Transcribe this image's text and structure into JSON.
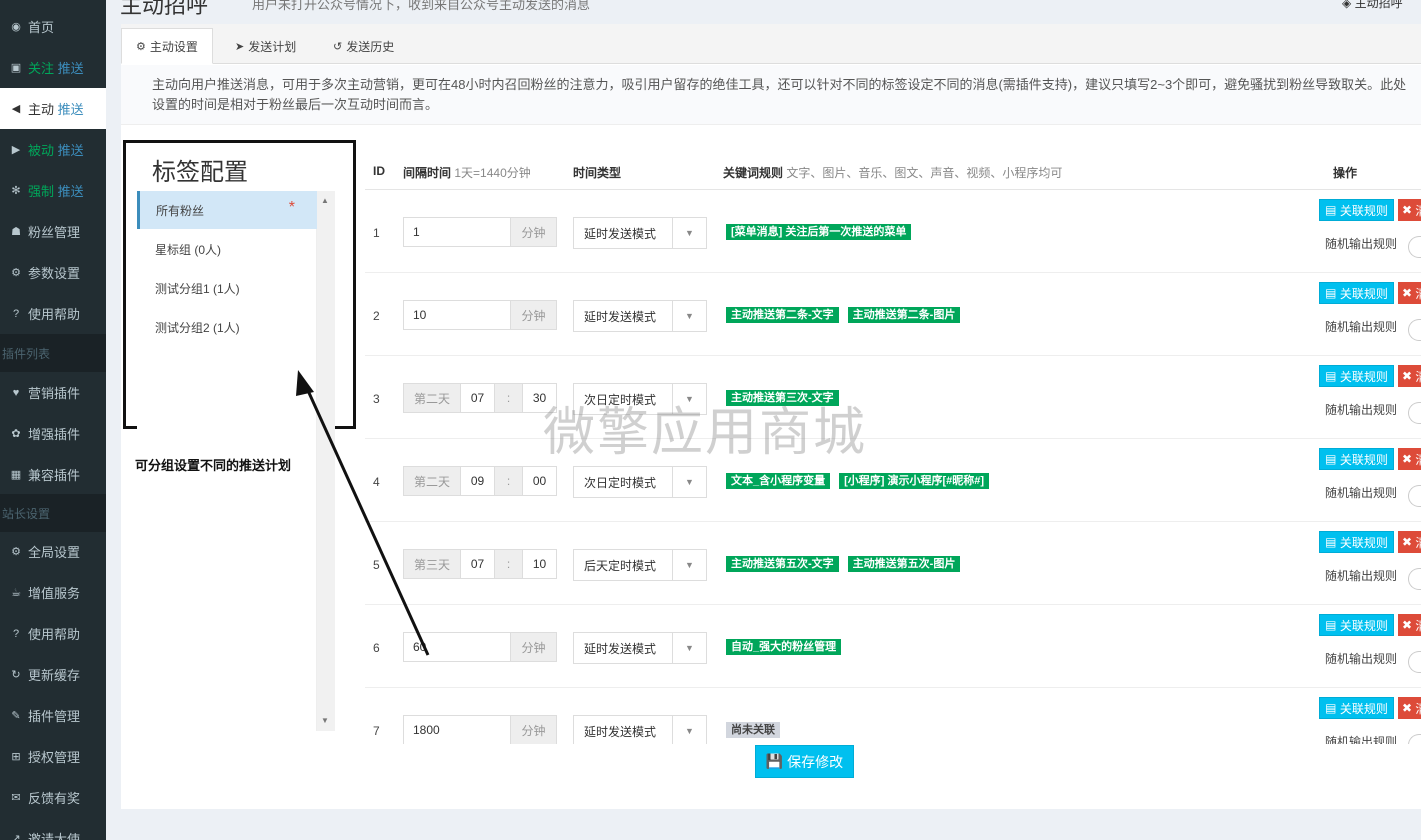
{
  "header": {
    "title": "主动招呼",
    "subtitle": "用户未打开公众号情况下，收到来自公众号主动发送的消息",
    "top_right": "主动招呼"
  },
  "sidebar": {
    "items": [
      {
        "icon": "dashboard-icon",
        "label": "首页",
        "tag": ""
      },
      {
        "icon": "rss-icon",
        "label": "关注",
        "tag": "推送"
      },
      {
        "icon": "arrow-circle-left-icon",
        "label": "主动",
        "tag": "推送"
      },
      {
        "icon": "arrow-circle-right-icon",
        "label": "被动",
        "tag": "推送"
      },
      {
        "icon": "asterisk-circle-icon",
        "label": "强制",
        "tag": "推送"
      },
      {
        "icon": "users-icon",
        "label": "粉丝管理",
        "tag": ""
      },
      {
        "icon": "gear-icon",
        "label": "参数设置",
        "tag": ""
      },
      {
        "icon": "question-circle-icon",
        "label": "使用帮助",
        "tag": ""
      }
    ],
    "header_plugins": "插件列表",
    "plugin_items": [
      {
        "icon": "heart-icon",
        "label": "营销插件"
      },
      {
        "icon": "paw-icon",
        "label": "增强插件"
      },
      {
        "icon": "grid-icon",
        "label": "兼容插件"
      }
    ],
    "header_site": "站长设置",
    "site_items": [
      {
        "icon": "gear-icon",
        "label": "全局设置"
      },
      {
        "icon": "coffee-icon",
        "label": "增值服务"
      },
      {
        "icon": "question-circle-icon",
        "label": "使用帮助"
      },
      {
        "icon": "refresh-icon",
        "label": "更新缓存"
      },
      {
        "icon": "wrench-icon",
        "label": "插件管理"
      },
      {
        "icon": "cart-icon",
        "label": "授权管理"
      },
      {
        "icon": "envelope-icon",
        "label": "反馈有奖"
      },
      {
        "icon": "share-icon",
        "label": "邀请大使"
      }
    ]
  },
  "tabs": [
    {
      "icon": "gears-icon",
      "label": "主动设置"
    },
    {
      "icon": "send-icon",
      "label": "发送计划"
    },
    {
      "icon": "history-icon",
      "label": "发送历史"
    }
  ],
  "notice": "主动向用户推送消息，可用于多次主动营销，更可在48小时内召回粉丝的注意力，吸引用户留存的绝佳工具，还可以针对不同的标签设定不同的消息(需插件支持)，建议只填写2~3个即可，避免骚扰到粉丝导致取关。此处设置的时间是相对于粉丝最后一次互动时间而言。",
  "tag_config": {
    "title": "标签配置",
    "items": [
      "所有粉丝",
      "星标组 (0人)",
      "测试分组1 (1人)",
      "测试分组2 (1人)"
    ],
    "star": "*"
  },
  "annotation": "可分组设置不同的推送计划",
  "table": {
    "headers": {
      "id": "ID",
      "interval": "间隔时间",
      "interval_hint": "1天=1440分钟",
      "type": "时间类型",
      "keyword": "关键词规则",
      "keyword_hint": "文字、图片、音乐、图文、声音、视频、小程序均可",
      "action": "操作"
    },
    "link_btn": "关联规则",
    "del_btn": "清",
    "random_label": "随机输出规则",
    "minute_unit": "分钟",
    "time_sep": ":",
    "rows": [
      {
        "id": "1",
        "mode": "minutes",
        "value": "1",
        "type": "延时发送模式",
        "labels": [
          "[菜单消息] 关注后第一次推送的菜单"
        ],
        "gray": false
      },
      {
        "id": "2",
        "mode": "minutes",
        "value": "10",
        "type": "延时发送模式",
        "labels": [
          "主动推送第二条-文字",
          "主动推送第二条-图片"
        ],
        "gray": false
      },
      {
        "id": "3",
        "mode": "day",
        "day": "第二天",
        "hour": "07",
        "min": "30",
        "type": "次日定时模式",
        "labels": [
          "主动推送第三次-文字"
        ],
        "gray": false
      },
      {
        "id": "4",
        "mode": "day",
        "day": "第二天",
        "hour": "09",
        "min": "00",
        "type": "次日定时模式",
        "labels": [
          "文本_含小程序变量",
          "[小程序] 演示小程序[#昵称#]"
        ],
        "gray": false
      },
      {
        "id": "5",
        "mode": "day",
        "day": "第三天",
        "hour": "07",
        "min": "10",
        "type": "后天定时模式",
        "labels": [
          "主动推送第五次-文字",
          "主动推送第五次-图片"
        ],
        "gray": false
      },
      {
        "id": "6",
        "mode": "minutes",
        "value": "60",
        "type": "延时发送模式",
        "labels": [
          "自动_强大的粉丝管理"
        ],
        "gray": false
      },
      {
        "id": "7",
        "mode": "minutes",
        "value": "1800",
        "type": "延时发送模式",
        "labels": [
          "尚未关联"
        ],
        "gray": true
      }
    ]
  },
  "save_btn": "保存修改",
  "watermark": "微擎应用商城",
  "colors": {
    "sidebar_bg": "#222d32",
    "label_green": "#00a65a",
    "info_btn": "#00c0ef",
    "danger_btn": "#dd4b39",
    "active_tag_bg": "#d2e7f7"
  }
}
